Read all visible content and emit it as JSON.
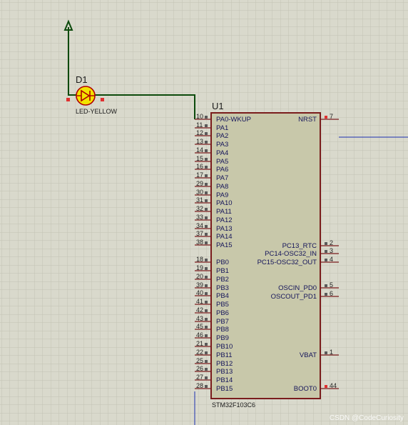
{
  "colors": {
    "background": "#d9d9cc",
    "grid": "#c3c3b4",
    "wire": "#0c4a0c",
    "blue_wire": "#1a2fb0",
    "ic_body": "#c8c8aa",
    "ic_border": "#7a1c1c",
    "pin_line": "#7a1c1c",
    "led_fill": "#f3e300",
    "led_outline": "#b00000",
    "pin_marker": "#e03030"
  },
  "icons": {
    "ground_arrow": "up-arrow-terminal-icon",
    "led": "led-diode-icon"
  },
  "d1": {
    "ref": "D1",
    "value": "LED-YELLOW"
  },
  "u1": {
    "ref": "U1",
    "part": "STM32F103C6",
    "left_pins": [
      {
        "num": "10",
        "label": "PA0-WKUP"
      },
      {
        "num": "11",
        "label": "PA1"
      },
      {
        "num": "12",
        "label": "PA2"
      },
      {
        "num": "13",
        "label": "PA3"
      },
      {
        "num": "14",
        "label": "PA4"
      },
      {
        "num": "15",
        "label": "PA5"
      },
      {
        "num": "16",
        "label": "PA6"
      },
      {
        "num": "17",
        "label": "PA7"
      },
      {
        "num": "29",
        "label": "PA8"
      },
      {
        "num": "30",
        "label": "PA9"
      },
      {
        "num": "31",
        "label": "PA10"
      },
      {
        "num": "32",
        "label": "PA11"
      },
      {
        "num": "33",
        "label": "PA12"
      },
      {
        "num": "34",
        "label": "PA13"
      },
      {
        "num": "37",
        "label": "PA14"
      },
      {
        "num": "38",
        "label": "PA15"
      },
      {
        "num": "18",
        "label": "PB0"
      },
      {
        "num": "19",
        "label": "PB1"
      },
      {
        "num": "20",
        "label": "PB2"
      },
      {
        "num": "39",
        "label": "PB3"
      },
      {
        "num": "40",
        "label": "PB4"
      },
      {
        "num": "41",
        "label": "PB5"
      },
      {
        "num": "42",
        "label": "PB6"
      },
      {
        "num": "43",
        "label": "PB7"
      },
      {
        "num": "45",
        "label": "PB8"
      },
      {
        "num": "46",
        "label": "PB9"
      },
      {
        "num": "21",
        "label": "PB10"
      },
      {
        "num": "22",
        "label": "PB11"
      },
      {
        "num": "25",
        "label": "PB12"
      },
      {
        "num": "26",
        "label": "PB13"
      },
      {
        "num": "27",
        "label": "PB14"
      },
      {
        "num": "28",
        "label": "PB15"
      }
    ],
    "right_pins": [
      {
        "num": "7",
        "label": "NRST"
      },
      {
        "num": "2",
        "label": "PC13_RTC"
      },
      {
        "num": "3",
        "label": "PC14-OSC32_IN"
      },
      {
        "num": "4",
        "label": "PC15-OSC32_OUT"
      },
      {
        "num": "5",
        "label": "OSCIN_PD0"
      },
      {
        "num": "6",
        "label": "OSCOUT_PD1"
      },
      {
        "num": "1",
        "label": "VBAT"
      },
      {
        "num": "44",
        "label": "BOOT0"
      }
    ]
  },
  "watermark": "CSDN @CodeCuriosity"
}
